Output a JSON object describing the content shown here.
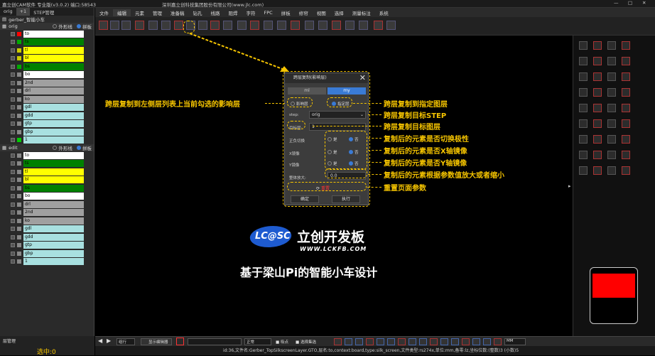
{
  "titlebar": {
    "app": "嘉立创CAM软件 专业版(v3.0.2) 端口:58543",
    "company": "深圳嘉立创科技集团股份有限公司(www.jlc.com)"
  },
  "leftpanel": {
    "tabs": [
      "orig",
      "+1",
      "STEP管理"
    ],
    "project": "gerber_智能小车",
    "groups": [
      {
        "name": "orig",
        "opt1": "外形线",
        "opt2": "拼板",
        "layers": [
          {
            "name": "to",
            "color": "#ff0000",
            "bg": "#ffffff"
          },
          {
            "name": "ts",
            "color": "#00aa00",
            "bg": "#008000"
          },
          {
            "name": "tl",
            "color": "#cccc00",
            "bg": "#ffff00"
          },
          {
            "name": "bl",
            "color": "#cccc00",
            "bg": "#ffff00"
          },
          {
            "name": "bs",
            "color": "#00aa00",
            "bg": "#008000"
          },
          {
            "name": "bo",
            "color": "#888888",
            "bg": "#ffffff"
          },
          {
            "name": "2nd",
            "color": "#888888",
            "bg": "#a0a0a0"
          },
          {
            "name": "drl",
            "color": "#888888",
            "bg": "#a0a0a0"
          },
          {
            "name": "ko",
            "color": "#888888",
            "bg": "#a0a0a0"
          },
          {
            "name": "gdl",
            "color": "#888888",
            "bg": "#a8e0e0"
          },
          {
            "name": "gdd",
            "color": "#888888",
            "bg": "#a8e0e0"
          },
          {
            "name": "gtp",
            "color": "#888888",
            "bg": "#a8e0e0"
          },
          {
            "name": "gbp",
            "color": "#888888",
            "bg": "#a8e0e0"
          },
          {
            "name": "1",
            "color": "#00cc00",
            "bg": "#a8e0e0"
          }
        ]
      },
      {
        "name": "edit",
        "opt1": "外形线",
        "opt2": "拼板",
        "layers": [
          {
            "name": "to",
            "color": "#888888",
            "bg": "#ffffff"
          },
          {
            "name": "ts",
            "color": "#888888",
            "bg": "#008000"
          },
          {
            "name": "tl",
            "color": "#888888",
            "bg": "#ffff00"
          },
          {
            "name": "bl",
            "color": "#888888",
            "bg": "#ffff00"
          },
          {
            "name": "bs",
            "color": "#888888",
            "bg": "#008000"
          },
          {
            "name": "bo",
            "color": "#888888",
            "bg": "#ffffff"
          },
          {
            "name": "drl",
            "color": "#888888",
            "bg": "#a0a0a0"
          },
          {
            "name": "2nd",
            "color": "#888888",
            "bg": "#a0a0a0"
          },
          {
            "name": "ko",
            "color": "#888888",
            "bg": "#a0a0a0"
          },
          {
            "name": "gdl",
            "color": "#888888",
            "bg": "#a8e0e0"
          },
          {
            "name": "gdd",
            "color": "#888888",
            "bg": "#a8e0e0"
          },
          {
            "name": "gtp",
            "color": "#888888",
            "bg": "#a8e0e0"
          },
          {
            "name": "gbp",
            "color": "#888888",
            "bg": "#a8e0e0"
          },
          {
            "name": "1",
            "color": "#888888",
            "bg": "#a8e0e0"
          }
        ]
      }
    ],
    "footer_btn": "层管理",
    "selected": "选中:0"
  },
  "menu": [
    "文件",
    "编辑",
    "元素",
    "管理",
    "准备稿",
    "钻孔",
    "线路",
    "阻焊",
    "字符",
    "FPC",
    "拼板",
    "修帘",
    "视图",
    "选择",
    "测量标注",
    "系统"
  ],
  "dialog": {
    "title": "跨层复制(影响层)",
    "tab_left": "ml",
    "tab_right": "my",
    "radio1": "影响层",
    "radio2": "指定层",
    "step_label": "step:",
    "step_value": "orig",
    "target_label": "目标层:",
    "target_value": "1",
    "polarity_label": "正负切换",
    "xmirror_label": "X镜像",
    "ymirror_label": "Y镜像",
    "yes": "是",
    "no": "否",
    "scale_label": "整体放大:",
    "scale_value": "0.0",
    "reset": "重置",
    "ok": "确定",
    "exec": "执行"
  },
  "annotations": {
    "left": "跨层复制到左侧层列表上当前勾选的影响层",
    "a1": "跨层复制到指定图层",
    "a2": "跨层复制目标STEP",
    "a3": "跨层复制目标图层",
    "a4": "复制后的元素是否切换极性",
    "a5": "复制后的元素是否X轴镜像",
    "a6": "复制后的元素是否Y轴镜像",
    "a7": "复制后的元素根据参数值放大或者缩小",
    "a8": "重置页面参数"
  },
  "brand": {
    "logo": "LC@SC",
    "name": "立创开发板",
    "url": "WWW.LCKFB.COM",
    "slogan": "基于梁山Pi的智能小车设计"
  },
  "bottombar": {
    "mode": "组行",
    "show_btn": "显示编辑器",
    "snap": "正常",
    "chk1": "吸点",
    "chk2": "选择集选",
    "unit": "MM"
  },
  "status": "id:36,文件名:Gerber_TopSilkscreenLayer.GTO,层名:to,context:board,type:silk_screen,文件类型:rs274x,单位:mm,备零:lz,坐标位数:(整数)3 (小数)5"
}
